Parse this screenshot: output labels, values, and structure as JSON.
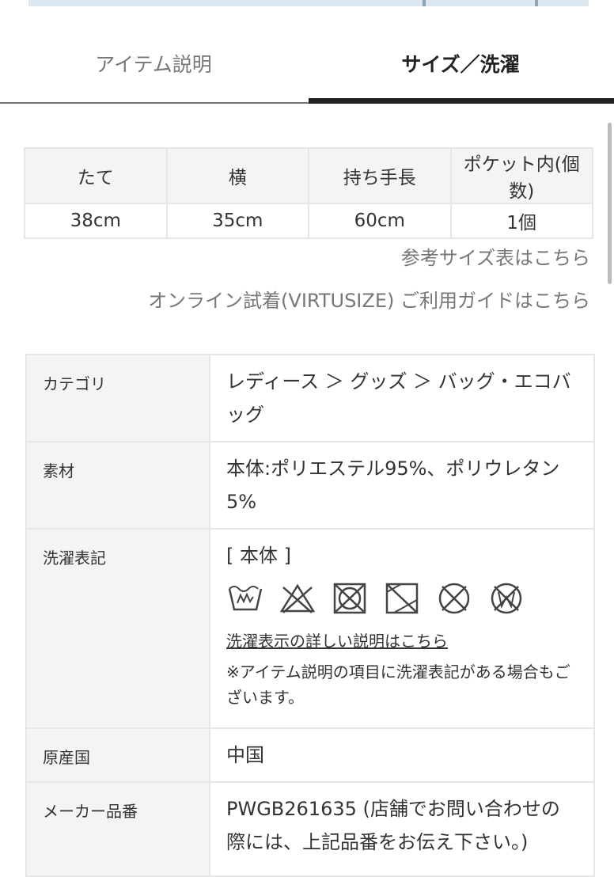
{
  "tabs": {
    "description_label": "アイテム説明",
    "size_label": "サイズ／洗濯"
  },
  "size_table": {
    "headers": [
      "たて",
      "横",
      "持ち手長",
      "ポケット内(個数)"
    ],
    "values": [
      "38cm",
      "35cm",
      "60cm",
      "1個"
    ]
  },
  "links": {
    "size_chart": "参考サイズ表はこちら",
    "virtusize": "オンライン試着(VIRTUSIZE) ご利用ガイドはこちら"
  },
  "spec": {
    "category": {
      "label": "カテゴリ",
      "value": "レディース ＞ グッズ ＞ バッグ・エコバッグ"
    },
    "material": {
      "label": "素材",
      "value": "本体:ポリエステル95%、ポリウレタン5%"
    },
    "care": {
      "label": "洗濯表記",
      "header": "[ 本体 ]",
      "icons": [
        "hand-wash-icon",
        "no-bleach-icon",
        "no-tumble-dry-icon",
        "drip-dry-shade-icon",
        "no-dry-clean-icon",
        "no-wet-clean-icon"
      ],
      "link": "洗濯表示の詳しい説明はこちら",
      "note": "※アイテム説明の項目に洗濯表記がある場合もございます。"
    },
    "origin": {
      "label": "原産国",
      "value": "中国"
    },
    "maker_number": {
      "label": "メーカー品番",
      "value": "PWGB261635 (店舗でお問い合わせの際には、上記品番をお伝え下さい。)"
    }
  },
  "colors": {
    "active_tab": "#222222",
    "muted_text": "#777777",
    "border": "#e6e6e6",
    "label_bg": "#f4f4f4"
  }
}
